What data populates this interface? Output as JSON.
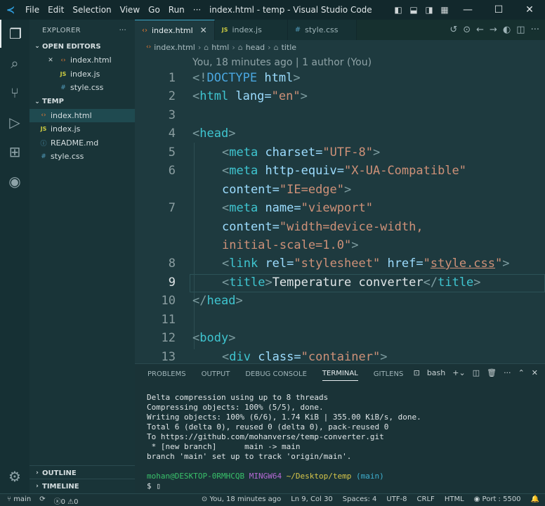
{
  "titlebar": {
    "menu": [
      "File",
      "Edit",
      "Selection",
      "View",
      "Go",
      "Run",
      "···"
    ],
    "title": "index.html - temp - Visual Studio Code",
    "controls": {
      "minimize": "—",
      "maximize": "☐",
      "close": "✕"
    }
  },
  "sidebar": {
    "header": "EXPLORER",
    "more": "···",
    "open_editors": {
      "label": "OPEN EDITORS",
      "items": [
        {
          "name": "index.html",
          "icon": "‹›",
          "close": "✕"
        },
        {
          "name": "index.js",
          "icon": "JS"
        },
        {
          "name": "style.css",
          "icon": "#"
        }
      ]
    },
    "folder": {
      "label": "TEMP",
      "items": [
        {
          "name": "index.html",
          "icon": "‹›"
        },
        {
          "name": "index.js",
          "icon": "JS"
        },
        {
          "name": "README.md",
          "icon": "ⓘ"
        },
        {
          "name": "style.css",
          "icon": "#"
        }
      ]
    },
    "outline": "OUTLINE",
    "timeline": "TIMELINE"
  },
  "tabs": [
    {
      "name": "index.html",
      "icon": "‹›",
      "close": "✕"
    },
    {
      "name": "index.js",
      "icon": "JS"
    },
    {
      "name": "style.css",
      "icon": "#"
    }
  ],
  "breadcrumb": [
    "index.html",
    "html",
    "head",
    "title"
  ],
  "editor": {
    "codelens": "You, 18 minutes ago | 1 author (You)",
    "line_numbers": [
      "1",
      "2",
      "3",
      "4",
      "5",
      "6",
      "7",
      "8",
      "9",
      "10",
      "11",
      "12",
      "13"
    ],
    "code": {
      "l1a": "<!",
      "l1b": "DOCTYPE",
      "l1c": " html",
      "l1d": ">",
      "l2a": "<",
      "l2b": "html",
      "l2c": " lang=",
      "l2d": "\"en\"",
      "l2e": ">",
      "l4a": "<",
      "l4b": "head",
      "l4c": ">",
      "l5a": "<",
      "l5b": "meta",
      "l5c": " charset=",
      "l5d": "\"UTF-8\"",
      "l5e": ">",
      "l6a": "<",
      "l6b": "meta",
      "l6c": " http-equiv=",
      "l6d": "\"X-UA-Compatible\"",
      "l6f": "content=",
      "l6g": "\"IE=edge\"",
      "l6h": ">",
      "l7a": "<",
      "l7b": "meta",
      "l7c": " name=",
      "l7d": "\"viewport\"",
      "l7f": "content=",
      "l7g": "\"width=device-width,",
      "l7i": "initial-scale=1.0\"",
      "l7j": ">",
      "l8a": "<",
      "l8b": "link",
      "l8c": " rel=",
      "l8d": "\"stylesheet\"",
      "l8e": " href=",
      "l8f": "\"",
      "l8g": "style.css",
      "l8h": "\"",
      "l8i": ">",
      "l9a": "<",
      "l9b": "title",
      "l9c": ">",
      "l9d": "Temperature converter",
      "l9e": "</",
      "l9f": "title",
      "l9g": ">",
      "l10a": "</",
      "l10b": "head",
      "l10c": ">",
      "l12a": "<",
      "l12b": "body",
      "l12c": ">",
      "l13a": "<",
      "l13b": "div",
      "l13c": " class=",
      "l13d": "\"container\"",
      "l13e": ">"
    }
  },
  "panel": {
    "tabs": [
      "PROBLEMS",
      "OUTPUT",
      "DEBUG CONSOLE",
      "TERMINAL",
      "GITLENS"
    ],
    "shell": "bash",
    "terminal_lines": [
      "Delta compression using up to 8 threads",
      "Compressing objects: 100% (5/5), done.",
      "Writing objects: 100% (6/6), 1.74 KiB | 355.00 KiB/s, done.",
      "Total 6 (delta 0), reused 0 (delta 0), pack-reused 0",
      "To https://github.com/mohanverse/temp-converter.git",
      " * [new branch]      main -> main",
      "branch 'main' set up to track 'origin/main'."
    ],
    "prompt": {
      "user": "mohan@DESKTOP-0RMHCQB",
      "host": "MINGW64",
      "path": "~/Desktop/temp",
      "branch": "(main)",
      "symbol": "$"
    }
  },
  "statusbar": {
    "branch": "main",
    "errors": "0",
    "warnings": "0",
    "blame": "You, 18 minutes ago",
    "position": "Ln 9, Col 30",
    "spaces": "Spaces: 4",
    "encoding": "UTF-8",
    "eol": "CRLF",
    "language": "HTML",
    "port": "Port : 5500"
  }
}
